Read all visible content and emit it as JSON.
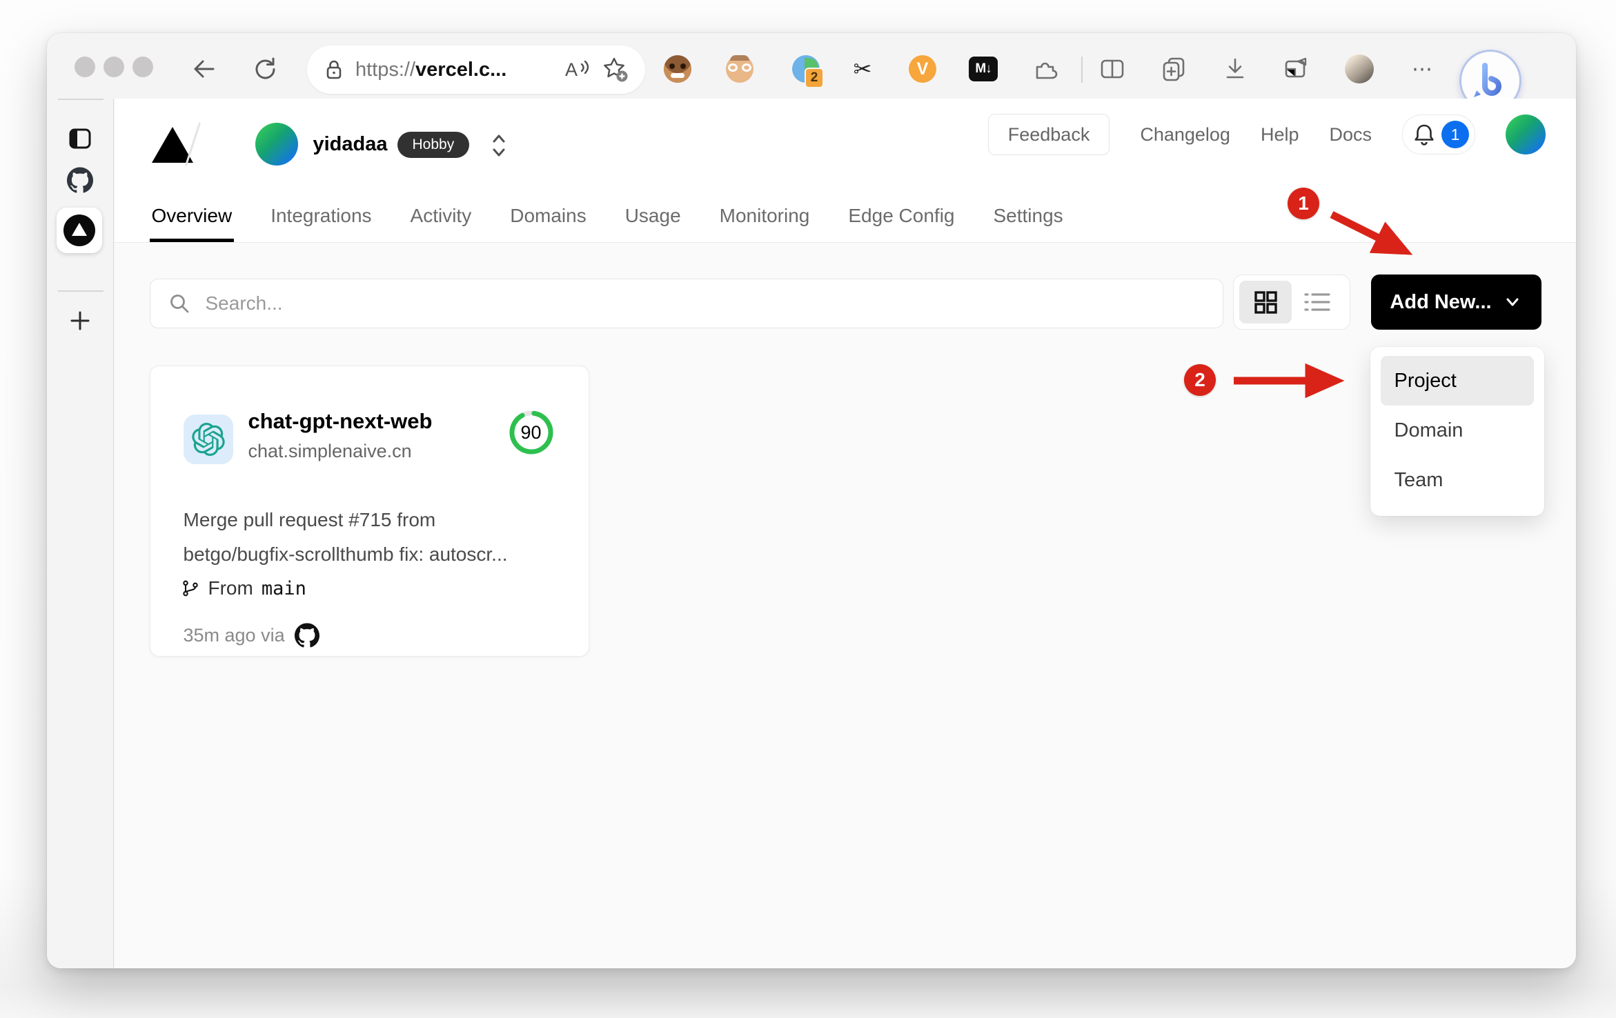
{
  "browser": {
    "url_scheme": "https://",
    "url_host": "vercel.c...",
    "read_aloud_letter": "A",
    "extension_badge_count": "2",
    "markdown_ext_label": "M↓",
    "v_ext_label": "V",
    "scissors_glyph": "✂",
    "more_glyph": "⋯",
    "bing_letter": "b"
  },
  "header": {
    "team": "yidadaa",
    "plan": "Hobby",
    "feedback": "Feedback",
    "changelog": "Changelog",
    "help": "Help",
    "docs": "Docs",
    "bell_count": "1"
  },
  "tabs": [
    {
      "label": "Overview"
    },
    {
      "label": "Integrations"
    },
    {
      "label": "Activity"
    },
    {
      "label": "Domains"
    },
    {
      "label": "Usage"
    },
    {
      "label": "Monitoring"
    },
    {
      "label": "Edge Config"
    },
    {
      "label": "Settings"
    }
  ],
  "controls": {
    "search_placeholder": "Search...",
    "add_new": "Add New..."
  },
  "dropdown": {
    "items": [
      {
        "label": "Project"
      },
      {
        "label": "Domain"
      },
      {
        "label": "Team"
      }
    ]
  },
  "card": {
    "name": "chat-gpt-next-web",
    "domain": "chat.simplenaive.cn",
    "score": "90",
    "commit_line1": "Merge pull request #715 from",
    "commit_line2": "betgo/bugfix-scrollthumb fix: autoscr...",
    "from_label": "From",
    "branch": "main",
    "meta": "35m ago via"
  },
  "annotations": {
    "step1": "1",
    "step2": "2"
  },
  "colors": {
    "accent_red": "#d92318",
    "vercel_blue": "#0b6ff0",
    "ring_green": "#2ec04f"
  }
}
